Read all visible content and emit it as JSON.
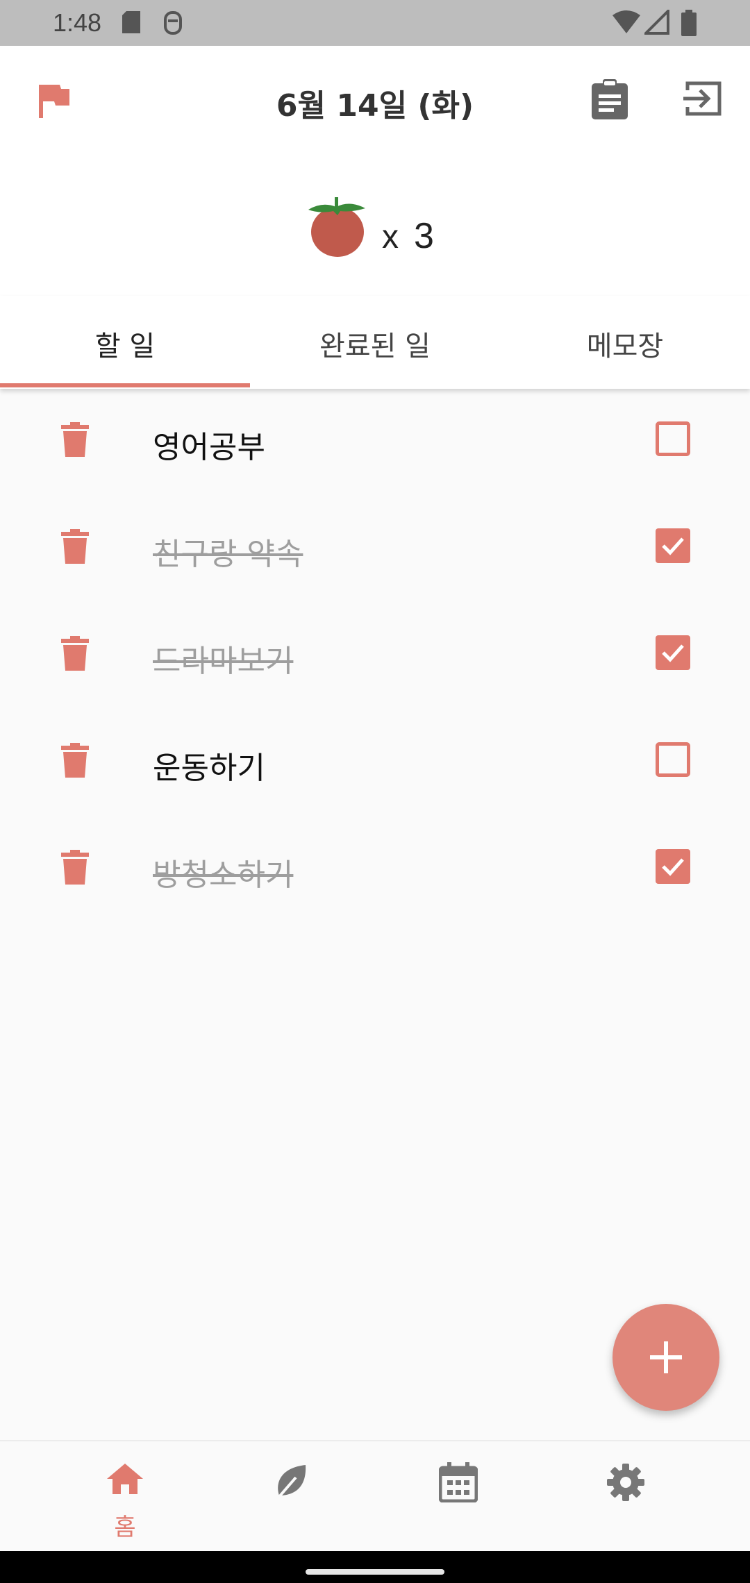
{
  "status_bar": {
    "time": "1:48"
  },
  "header": {
    "date": "6월 14일 (화)"
  },
  "counter": {
    "multiply": "x",
    "count": "3"
  },
  "tabs": [
    {
      "label": "할 일",
      "active": true
    },
    {
      "label": "완료된 일",
      "active": false
    },
    {
      "label": "메모장",
      "active": false
    }
  ],
  "tasks": [
    {
      "label": "영어공부",
      "done": false
    },
    {
      "label": "친구랑 약속",
      "done": true
    },
    {
      "label": "드라마보기",
      "done": true
    },
    {
      "label": "운동하기",
      "done": false
    },
    {
      "label": "방청소하기",
      "done": true
    }
  ],
  "bottom_nav": {
    "home_label": "홈"
  },
  "colors": {
    "accent": "#e07a6e",
    "fab": "#e0867a",
    "icon_gray": "#777777",
    "done_text": "#9e9e9e"
  },
  "icons": {
    "header": [
      "flag-icon",
      "clipboard-icon",
      "exit-icon"
    ],
    "nav": [
      "home-icon",
      "leaf-icon",
      "calendar-icon",
      "gear-icon"
    ],
    "task": [
      "trash-icon",
      "checkbox-icon"
    ],
    "fab": "plus-icon"
  }
}
